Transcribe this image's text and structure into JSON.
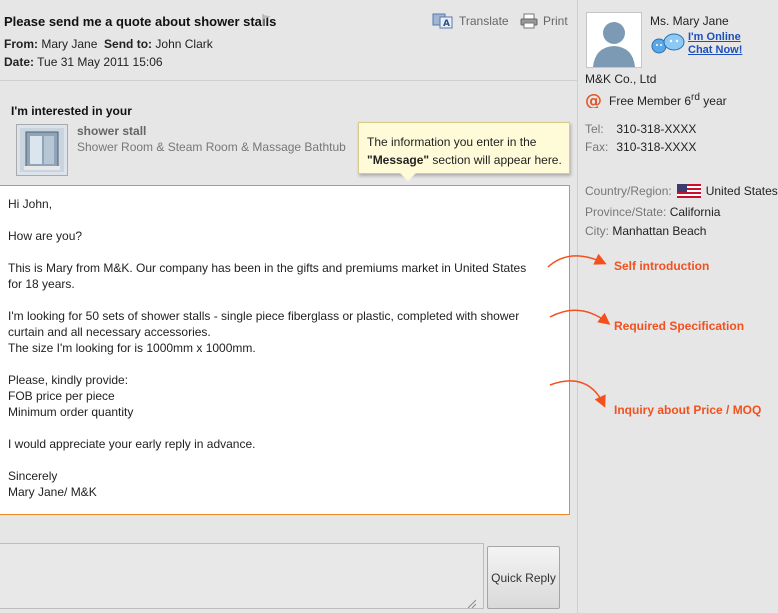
{
  "mail": {
    "subject": "Please send me a quote about shower stalls",
    "translate_label": "Translate",
    "print_label": "Print",
    "from_label": "From:",
    "from_value": "Mary Jane",
    "sendto_label": "Send to:",
    "sendto_value": "John Clark",
    "date_label": "Date:",
    "date_value": "Tue  31 May 2011  15:06",
    "interest_label": "I'm interested in your",
    "product_name": "shower stall",
    "product_desc": "Shower Room & Steam Room & Massage Bathtub",
    "tooltip_pre": "The information you enter in the",
    "tooltip_bold": "\"Message\"",
    "tooltip_post": " section will appear here.",
    "message": {
      "greeting": "Hi John,",
      "how": "How are you?",
      "intro_1": "This is Mary from M&K. Our company has been in the gifts and premiums market in United States",
      "intro_2": "for 18 years.",
      "spec_1": "I'm looking for 50 sets of shower stalls - single piece fiberglass or plastic, completed with shower",
      "spec_2": "curtain and all necessary accessories.",
      "spec_3": "The size I'm looking for is 1000mm x 1000mm.",
      "provide_1": "Please, kindly provide:",
      "provide_2": "FOB price per piece",
      "provide_3": "Minimum order quantity",
      "appreciate": "I would appreciate your early reply in advance.",
      "sign_1": "Sincerely",
      "sign_2": "Mary Jane/ M&K"
    },
    "reply_value": "",
    "quick_reply_label": "Quick Reply"
  },
  "contact": {
    "name": "Ms. Mary Jane",
    "online_line1": "I'm Online",
    "online_line2": "Chat Now!",
    "company": "M&K Co., Ltd",
    "member_pre": "Free Member 6",
    "member_sup": "rd",
    "member_post": " year",
    "tel_label": "Tel:",
    "tel_value": "310-318-XXXX",
    "fax_label": "Fax:",
    "fax_value": "310-318-XXXX",
    "country_label": "Country/Region:",
    "country_value": "United States",
    "province_label": "Province/State:",
    "province_value": "California",
    "city_label": "City:",
    "city_value": "Manhattan Beach"
  },
  "annotations": {
    "self_intro": "Self introduction",
    "required_spec": "Required Specification",
    "inquiry": "Inquiry about Price / MOQ"
  },
  "colors": {
    "accent_orange": "#f08a24",
    "annotation_red": "#f4501e",
    "link_blue": "#1e4fb8",
    "tooltip_bg": "#fffbd8"
  }
}
